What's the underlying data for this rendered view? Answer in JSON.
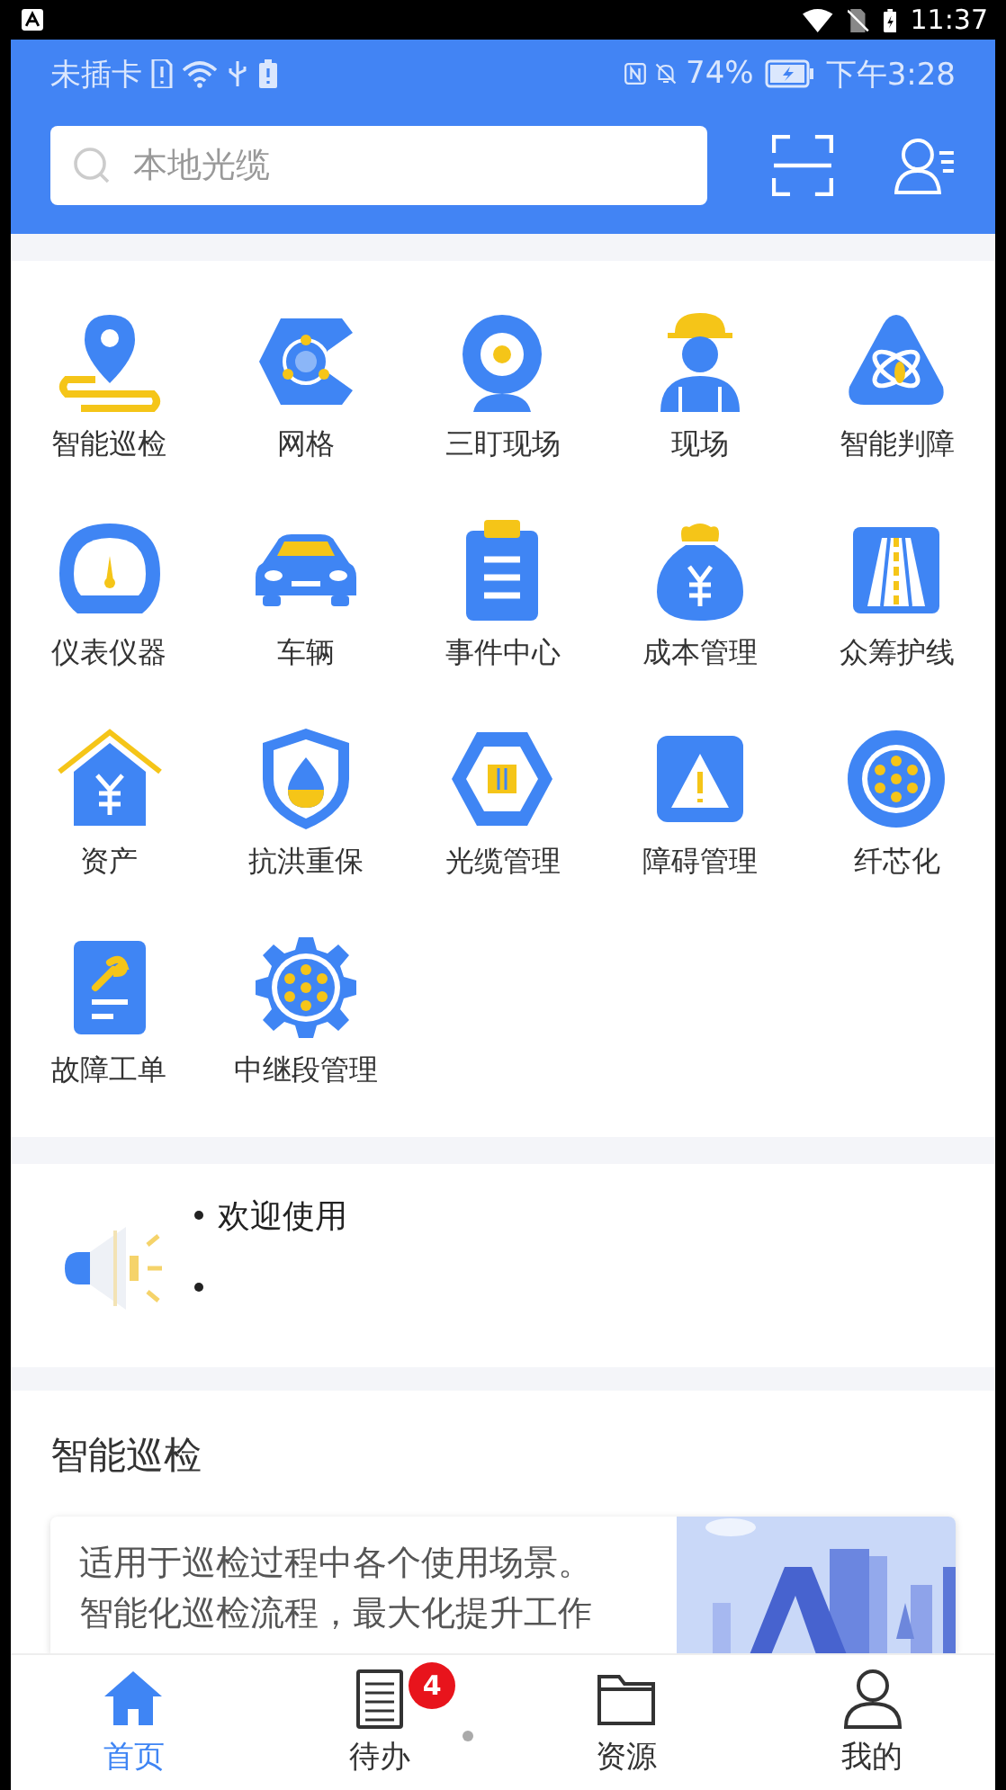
{
  "system_bar": {
    "time": "11:37"
  },
  "status_bar": {
    "carrier": "未插卡",
    "battery": "74%",
    "time": "下午3:28"
  },
  "search": {
    "placeholder": "本地光缆"
  },
  "apps": [
    {
      "label": "智能巡检"
    },
    {
      "label": "网格"
    },
    {
      "label": "三盯现场"
    },
    {
      "label": "现场"
    },
    {
      "label": "智能判障"
    },
    {
      "label": "仪表仪器"
    },
    {
      "label": "车辆"
    },
    {
      "label": "事件中心"
    },
    {
      "label": "成本管理"
    },
    {
      "label": "众筹护线"
    },
    {
      "label": "资产"
    },
    {
      "label": "抗洪重保"
    },
    {
      "label": "光缆管理"
    },
    {
      "label": "障碍管理"
    },
    {
      "label": "纤芯化"
    },
    {
      "label": "故障工单"
    },
    {
      "label": "中继段管理"
    }
  ],
  "notices": [
    {
      "kind": "text",
      "text": "欢迎使用"
    },
    {
      "kind": "empty"
    }
  ],
  "section": {
    "title": "智能巡检",
    "description": "适用于巡检过程中各个使用场景。智能化巡检流程，最大化提升工作"
  },
  "tabs": [
    {
      "label": "首页",
      "selected": true
    },
    {
      "label": "待办",
      "selected": false,
      "badge": "4"
    },
    {
      "label": "资源",
      "selected": false
    },
    {
      "label": "我的",
      "selected": false
    }
  ]
}
